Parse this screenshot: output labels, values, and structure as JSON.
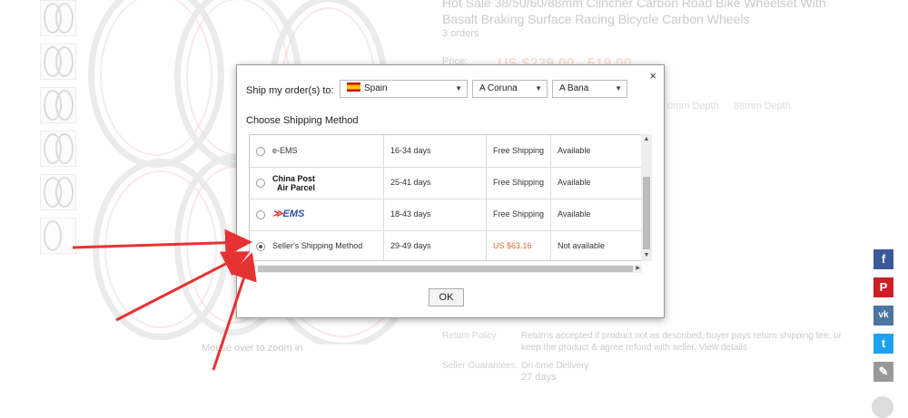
{
  "product": {
    "title": "Hot Sale 38/50/60/88mm Clincher Carbon Road Bike Wheelset With Basalt Braking Surface Racing Bicycle Carbon Wheels",
    "orders": "3 orders",
    "price_label": "Price:",
    "price_value": "US $229.00 - 519.00",
    "depth_options": [
      "0mm Depth",
      "88mm Depth"
    ],
    "zoom_hint": "Mouse over to zoom in",
    "return_policy_label": "Return Policy",
    "return_policy_text": "Returns accepted if product not as described, buyer pays return shipping fee; or keep the product & agree refund with seller.",
    "return_policy_link": "View details",
    "seller_guarantees_label": "Seller Guarantees:",
    "seller_guarantees_item": "On-time Delivery",
    "seller_guarantees_days": "27 days"
  },
  "modal": {
    "ship_to_label": "Ship my order(s) to:",
    "country": "Spain",
    "province": "A Coruna",
    "city": "A Bana",
    "choose_label": "Choose Shipping Method",
    "close": "×",
    "ok_label": "OK",
    "methods": [
      {
        "name": "e-EMS",
        "time": "16-34 days",
        "cost": "Free Shipping",
        "tracking": "Available",
        "checked": false
      },
      {
        "name": "China Post Air Parcel",
        "logo_line1": "China Post",
        "logo_line2": "Air Parcel",
        "time": "25-41 days",
        "cost": "Free Shipping",
        "tracking": "Available",
        "checked": false
      },
      {
        "name": "EMS",
        "logo": "EMS",
        "time": "18-43 days",
        "cost": "Free Shipping",
        "tracking": "Available",
        "checked": false
      },
      {
        "name": "Seller's Shipping Method",
        "time": "29-49 days",
        "cost": "US $63.16",
        "tracking": "Not available",
        "checked": true
      }
    ]
  },
  "social": {
    "icons": [
      "facebook-icon",
      "pinterest-icon",
      "vk-icon",
      "twitter-icon",
      "edit-icon"
    ],
    "glyphs": [
      "f",
      "P",
      "vk",
      "t",
      "✎"
    ],
    "colors": [
      "#3b5998",
      "#cb2027",
      "#4c75a3",
      "#1da1f2",
      "#999999"
    ]
  },
  "colors": {
    "accent_price": "#e8673a",
    "annotation_arrow": "#e63232"
  }
}
